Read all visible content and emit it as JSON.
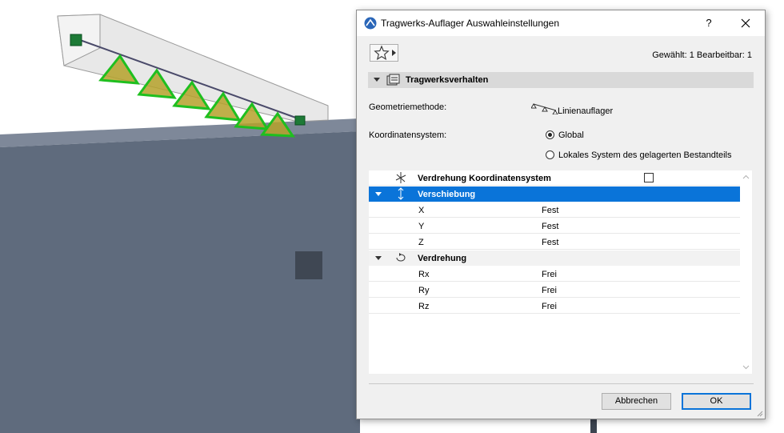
{
  "dialog": {
    "title": "Tragwerks-Auflager Auswahleinstellungen",
    "help_label": "?",
    "selected_info": "Gewählt: 1 Bearbeitbar: 1",
    "section_title": "Tragwerksverhalten",
    "geometry_method_label": "Geometriemethode:",
    "geometry_method_value": "Linienauflager",
    "coord_system_label": "Koordinatensystem:",
    "coord_options": [
      "Global",
      "Lokales System des gelagerten Bestandteils"
    ],
    "coord_selected": "Global",
    "table": {
      "rotation_coord_label": "Verdrehung Koordinatensystem",
      "rotation_coord_checked": false,
      "translation_group": "Verschiebung",
      "translation_rows": [
        {
          "name": "X",
          "value": "Fest"
        },
        {
          "name": "Y",
          "value": "Fest"
        },
        {
          "name": "Z",
          "value": "Fest"
        }
      ],
      "rotation_group": "Verdrehung",
      "rotation_rows": [
        {
          "name": "Rx",
          "value": "Frei"
        },
        {
          "name": "Ry",
          "value": "Frei"
        },
        {
          "name": "Rz",
          "value": "Frei"
        }
      ]
    },
    "cancel_label": "Abbrechen",
    "ok_label": "OK"
  },
  "colors": {
    "accent": "#0a74d9",
    "wall": "#5f6b7d",
    "support_fill": "#b5a12a",
    "support_edge": "#1fbf1f"
  }
}
